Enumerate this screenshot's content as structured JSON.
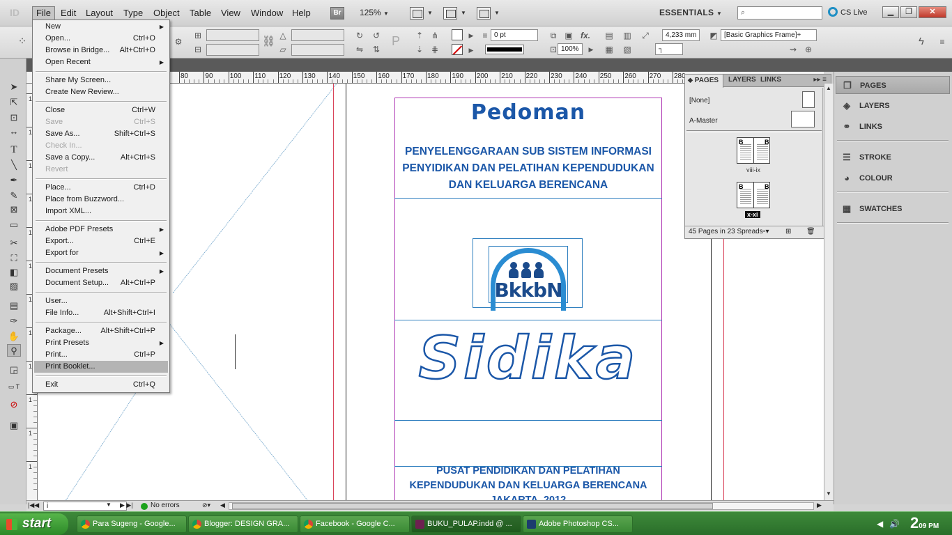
{
  "app": {
    "logo": "ID"
  },
  "menubar": {
    "items": [
      "File",
      "Edit",
      "Layout",
      "Type",
      "Object",
      "Table",
      "View",
      "Window",
      "Help"
    ],
    "bridge_badge": "Br",
    "zoom": "125%",
    "workspace": "ESSENTIALS",
    "search_placeholder": "",
    "cs_live": "CS Live"
  },
  "controlbar": {
    "stroke_weight": "0 pt",
    "width_value": "4,233 mm",
    "scale_value": "100%",
    "object_style": "[Basic Graphics Frame]+"
  },
  "file_menu": {
    "items": [
      {
        "label": "New",
        "shortcut": "",
        "submenu": true
      },
      {
        "label": "Open...",
        "shortcut": "Ctrl+O"
      },
      {
        "label": "Browse in Bridge...",
        "shortcut": "Alt+Ctrl+O"
      },
      {
        "label": "Open Recent",
        "shortcut": "",
        "submenu": true
      },
      {
        "label": "Share My Screen...",
        "shortcut": ""
      },
      {
        "label": "Create New Review...",
        "shortcut": ""
      },
      {
        "label": "Close",
        "shortcut": "Ctrl+W"
      },
      {
        "label": "Save",
        "shortcut": "Ctrl+S",
        "disabled": true
      },
      {
        "label": "Save As...",
        "shortcut": "Shift+Ctrl+S"
      },
      {
        "label": "Check In...",
        "shortcut": "",
        "disabled": true
      },
      {
        "label": "Save a Copy...",
        "shortcut": "Alt+Ctrl+S"
      },
      {
        "label": "Revert",
        "shortcut": "",
        "disabled": true
      },
      {
        "label": "Place...",
        "shortcut": "Ctrl+D"
      },
      {
        "label": "Place from Buzzword...",
        "shortcut": ""
      },
      {
        "label": "Import XML...",
        "shortcut": ""
      },
      {
        "label": "Adobe PDF Presets",
        "shortcut": "",
        "submenu": true
      },
      {
        "label": "Export...",
        "shortcut": "Ctrl+E"
      },
      {
        "label": "Export for",
        "shortcut": "",
        "submenu": true
      },
      {
        "label": "Document Presets",
        "shortcut": "",
        "submenu": true
      },
      {
        "label": "Document Setup...",
        "shortcut": "Alt+Ctrl+P"
      },
      {
        "label": "User...",
        "shortcut": ""
      },
      {
        "label": "File Info...",
        "shortcut": "Alt+Shift+Ctrl+I"
      },
      {
        "label": "Package...",
        "shortcut": "Alt+Shift+Ctrl+P"
      },
      {
        "label": "Print Presets",
        "shortcut": "",
        "submenu": true
      },
      {
        "label": "Print...",
        "shortcut": "Ctrl+P"
      },
      {
        "label": "Print Booklet...",
        "shortcut": "",
        "highlighted": true
      },
      {
        "label": "Exit",
        "shortcut": "Ctrl+Q"
      }
    ]
  },
  "ruler": {
    "h_labels": [
      "80",
      "90",
      "100",
      "110",
      "120",
      "130",
      "140",
      "150",
      "160",
      "170",
      "180",
      "190",
      "200",
      "210",
      "220",
      "230",
      "240",
      "250",
      "260",
      "270",
      "280"
    ],
    "v_labels": [
      "1",
      "1",
      "1",
      "1",
      "1",
      "1",
      "1",
      "1",
      "1",
      "1",
      "1",
      "1"
    ]
  },
  "document": {
    "title": "Pedoman",
    "subtitle_lines": [
      "PENYELENGGARAAN SUB SISTEM INFORMASI",
      "PENYIDIKAN DAN PELATIHAN KEPENDUDUKAN",
      "DAN KELUARGA BERENCANA"
    ],
    "logo_text": "BkkbN",
    "brand": "Sidika",
    "footer_lines": [
      "PUSAT PENDIDIKAN DAN PELATIHAN",
      "KEPENDUDUKAN DAN KELUARGA BERENCANA",
      "JAKARTA, 2012"
    ]
  },
  "pages_panel": {
    "tabs": [
      "PAGES",
      "LAYERS",
      "LINKS"
    ],
    "none_label": "[None]",
    "master_label": "A-Master",
    "spreads": [
      {
        "label": "viii-ix",
        "left_letter": "B",
        "right_letter": "B",
        "selected": false
      },
      {
        "label": "x-xi",
        "left_letter": "B",
        "right_letter": "B",
        "selected": true
      }
    ],
    "footer": "45 Pages in 23 Spreads"
  },
  "dock": {
    "group1": [
      "PAGES",
      "LAYERS",
      "LINKS"
    ],
    "group2": [
      "STROKE",
      "COLOUR"
    ],
    "group3": [
      "SWATCHES"
    ]
  },
  "statusbar": {
    "page_field": "i",
    "preflight": "No errors"
  },
  "taskbar": {
    "start": "start",
    "tasks": [
      {
        "label": "Para Sugeng - Google...",
        "icon": "chrome"
      },
      {
        "label": "Blogger: DESIGN GRA...",
        "icon": "chrome"
      },
      {
        "label": "Facebook - Google C...",
        "icon": "chrome"
      },
      {
        "label": "BUKU_PULAP.indd @ ...",
        "icon": "id",
        "active": true
      },
      {
        "label": "Adobe Photoshop CS...",
        "icon": "ps"
      }
    ],
    "clock_hour": "2",
    "clock_min": "09",
    "clock_ampm": "PM"
  }
}
